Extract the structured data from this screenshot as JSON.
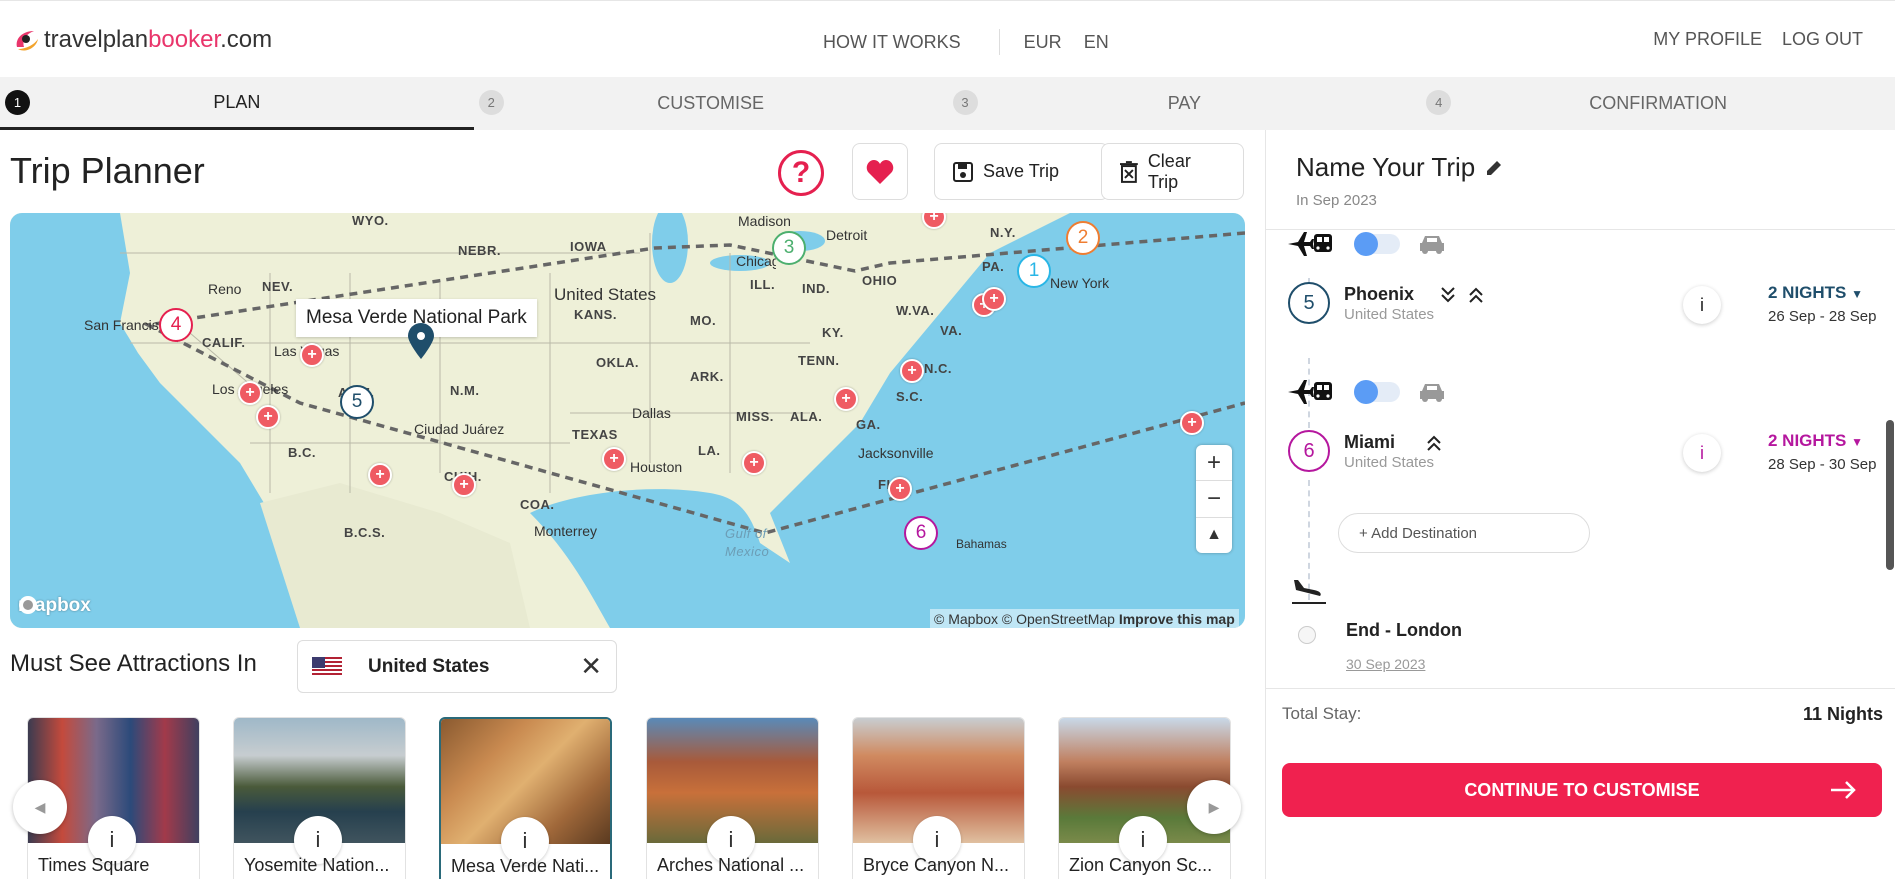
{
  "header": {
    "logo_a": "travelplan",
    "logo_b": "booker",
    "logo_c": ".com",
    "how_it_works": "HOW IT WORKS",
    "currency": "EUR",
    "language": "EN",
    "my_profile": "MY PROFILE",
    "log_out": "LOG OUT"
  },
  "steps": [
    {
      "num": "1",
      "label": "PLAN"
    },
    {
      "num": "2",
      "label": "CUSTOMISE"
    },
    {
      "num": "3",
      "label": "PAY"
    },
    {
      "num": "4",
      "label": "CONFIRMATION"
    }
  ],
  "planner": {
    "title": "Trip Planner",
    "help": "?",
    "save_trip": "Save Trip",
    "clear_trip": "Clear Trip"
  },
  "map": {
    "tooltip": "Mesa Verde National Park",
    "regions": [
      "WYO.",
      "NEBR.",
      "IOWA",
      "N.Y.",
      "NEV.",
      "United States",
      "KANS.",
      "ILL.",
      "IND.",
      "OHIO",
      "PA.",
      "CALIF.",
      "MO.",
      "W.VA.",
      "VA.",
      "KY.",
      "OKLA.",
      "TENN.",
      "N.C.",
      "ARIZ.",
      "N.M.",
      "ARK.",
      "S.C.",
      "TEXAS",
      "MISS.",
      "ALA.",
      "GA.",
      "LA.",
      "FL",
      "B.C.",
      "CHIH.",
      "COA.",
      "B.C.S.",
      "Gulf of Mexico"
    ],
    "cities": [
      "Madison",
      "Detroit",
      "Chicago",
      "New York",
      "Reno",
      "San Francisco",
      "Las Vegas",
      "Los Angeles",
      "Ciudad Juárez",
      "Dallas",
      "Houston",
      "Jacksonville",
      "Monterrey",
      "Bahamas"
    ],
    "pins": [
      "1",
      "2",
      "3",
      "4",
      "5",
      "6"
    ],
    "zoom_in": "+",
    "zoom_out": "−",
    "compass": "▲",
    "brand": "mapbox",
    "attribution_a": "© Mapbox © OpenStreetMap",
    "attribution_b": "Improve this map"
  },
  "attractions": {
    "title": "Must See Attractions In",
    "country": "United States",
    "clear": "✕",
    "info": "i",
    "cards": [
      {
        "name": "Times Square"
      },
      {
        "name": "Yosemite Nation..."
      },
      {
        "name": "Mesa Verde Nati..."
      },
      {
        "name": "Arches National ..."
      },
      {
        "name": "Bryce Canyon N..."
      },
      {
        "name": "Zion Canyon Sc..."
      }
    ]
  },
  "trip": {
    "name": "Name Your Trip",
    "date": "In Sep 2023",
    "destinations": [
      {
        "num": "5",
        "city": "Phoenix",
        "country": "United States",
        "nights": "2 NIGHTS",
        "range": "26 Sep - 28 Sep",
        "color": "#1f4e6b"
      },
      {
        "num": "6",
        "city": "Miami",
        "country": "United States",
        "nights": "2 NIGHTS",
        "range": "28 Sep - 30 Sep",
        "color": "#b5179e"
      }
    ],
    "add_destination": "+ Add Destination",
    "end_label": "End - London",
    "end_date": "30 Sep 2023",
    "info": "i",
    "total_label": "Total Stay:",
    "total_value": "11 Nights",
    "continue": "CONTINUE TO CUSTOMISE"
  },
  "colors": {
    "accent": "#f0214f",
    "pin1": "#29b6e6",
    "pin2": "#ef7d31",
    "pin3": "#4caf6e",
    "pin4": "#e5204f",
    "pin5": "#1f4e6b",
    "pin6": "#b5179e"
  }
}
